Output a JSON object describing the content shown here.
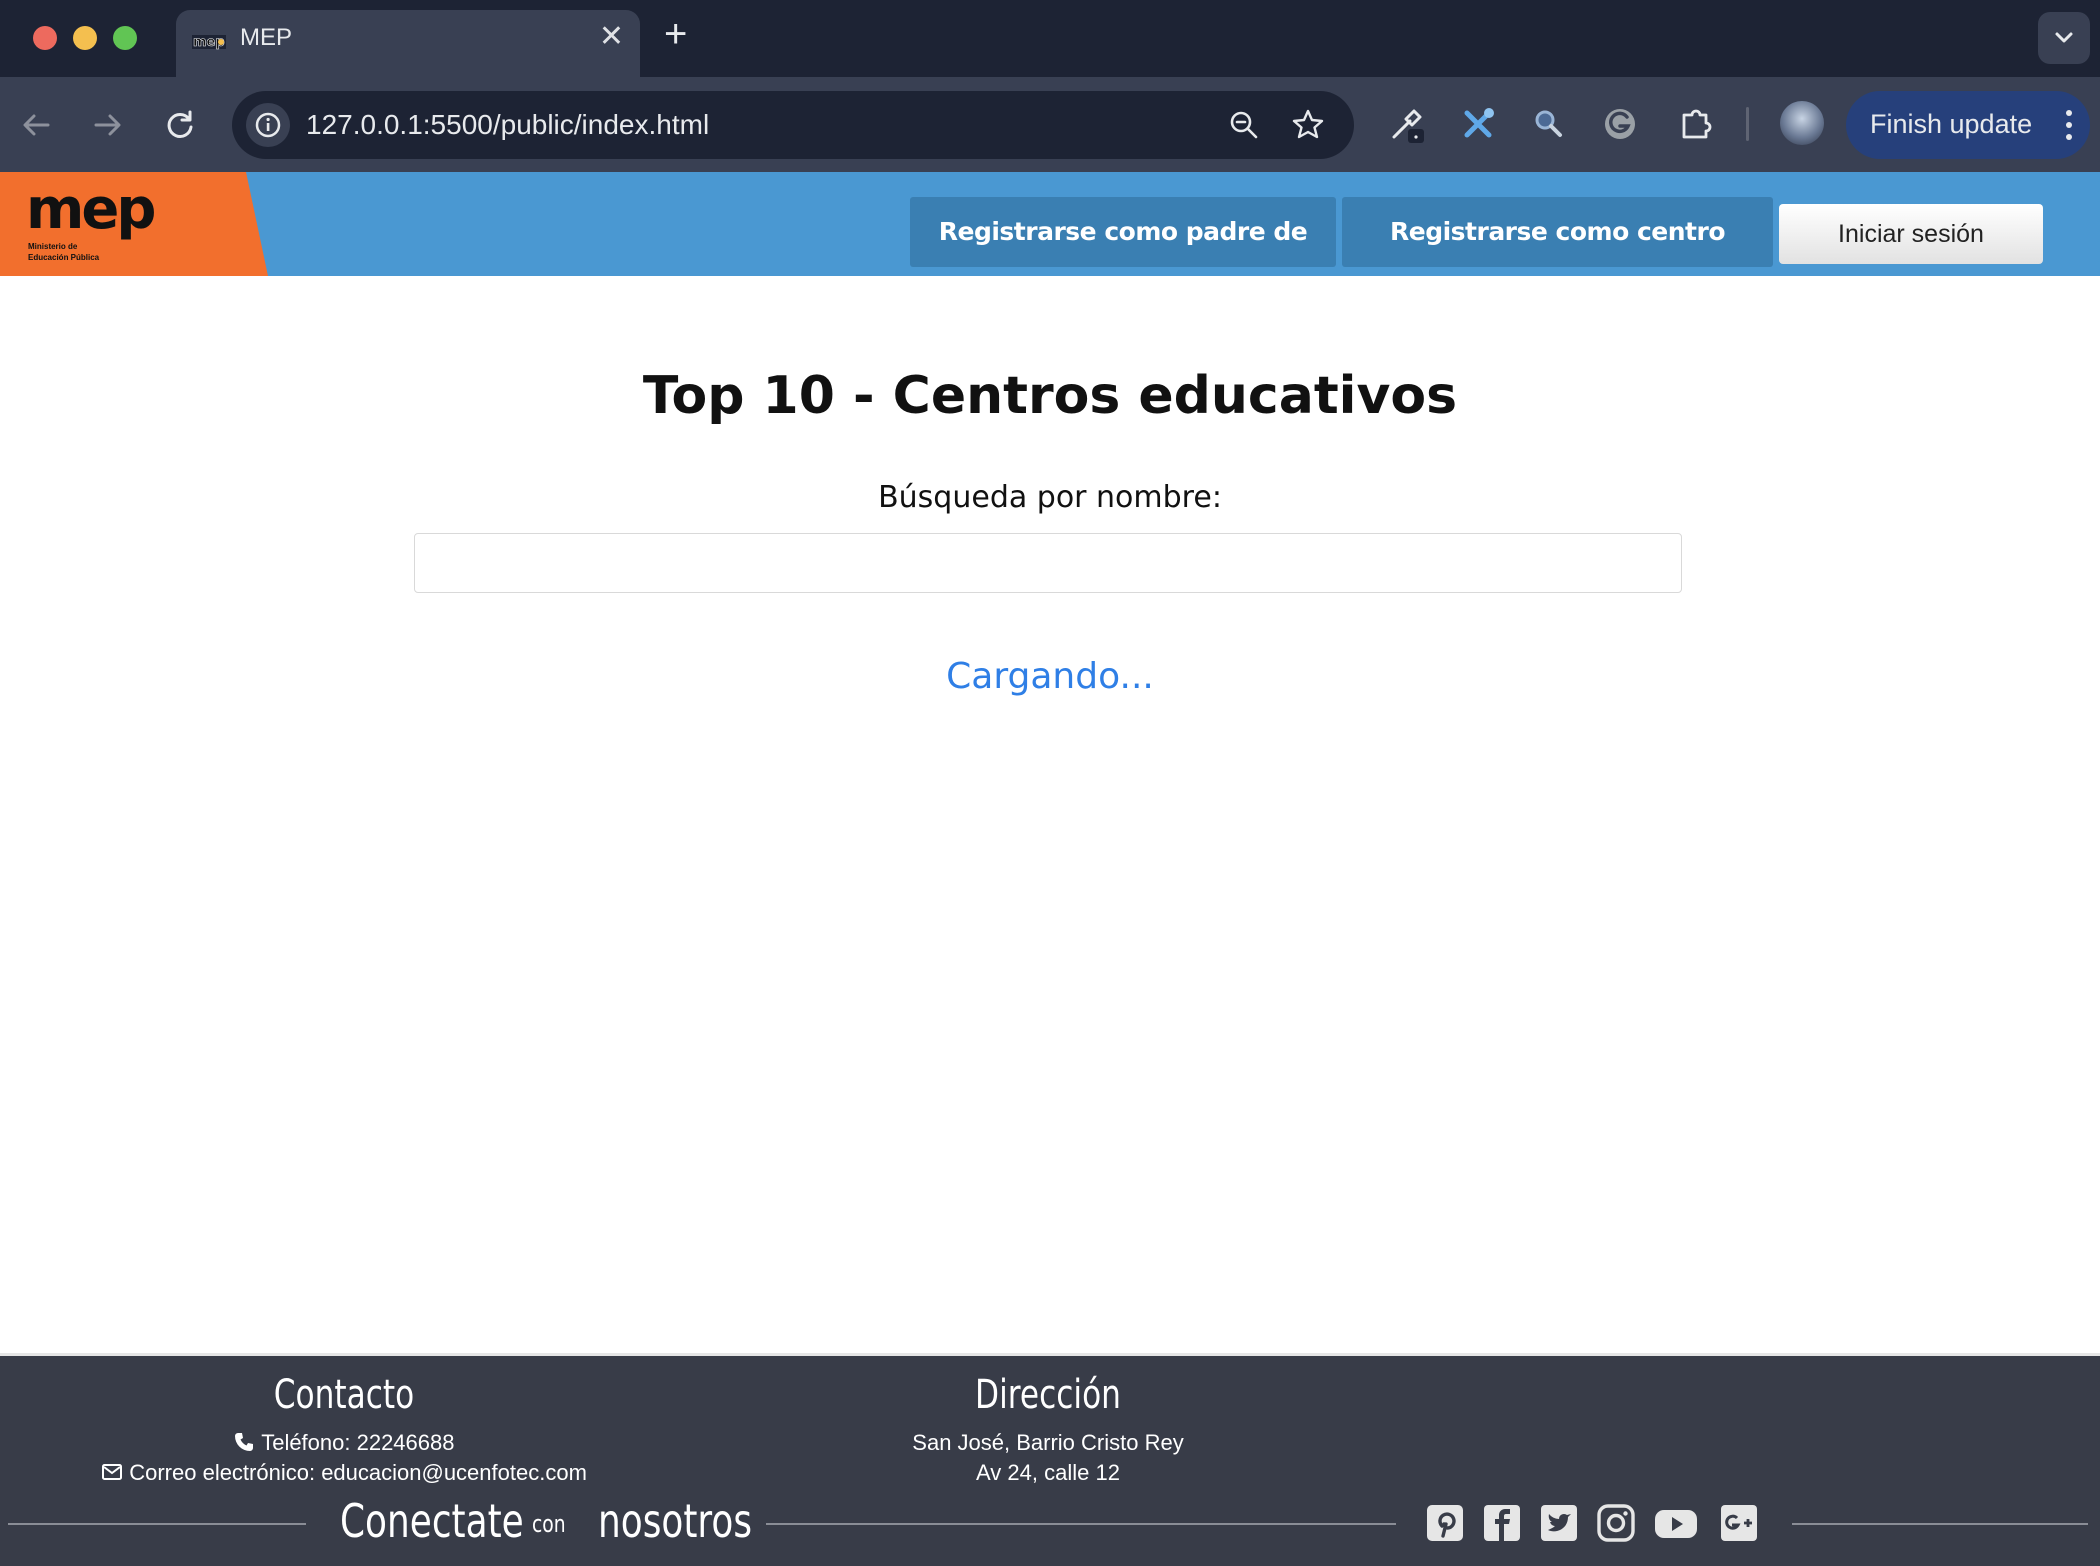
{
  "browser": {
    "tab": {
      "title": "MEP",
      "favicon": "mep-favicon"
    },
    "address_bar": {
      "url": "127.0.0.1:5500/public/index.html"
    },
    "update_button": {
      "label": "Finish update"
    },
    "icons": [
      "back-icon",
      "forward-icon",
      "reload-icon",
      "site-info-icon",
      "zoom-icon",
      "bookmark-star-icon",
      "eyedropper-extension-icon",
      "tools-extension-icon",
      "search-extension-icon",
      "grammarly-extension-icon",
      "extensions-puzzle-icon",
      "profile-avatar",
      "kebab-menu-icon",
      "tab-search-chevron-icon"
    ]
  },
  "header": {
    "logo": {
      "word": "mep",
      "line1": "Ministerio de",
      "line2": "Educación Pública"
    },
    "nav": {
      "register_parent": "Registrarse como padre de familia",
      "register_school": "Registrarse como centro educativo",
      "login": "Iniciar sesión"
    },
    "colors": {
      "bar": "#4a98d2",
      "logo_bg": "#f26f2d",
      "button_bg": "#3a7fb2"
    }
  },
  "main": {
    "title": "Top 10 - Centros educativos",
    "search": {
      "label": "Búsqueda por nombre:",
      "value": ""
    },
    "status": "Cargando...",
    "status_color": "#2f7fe6"
  },
  "footer": {
    "contact": {
      "heading": "Contacto",
      "phone": "Teléfono: 22246688",
      "email": "Correo electrónico: educacion@ucenfotec.com"
    },
    "address": {
      "heading": "Dirección",
      "line1": "San José, Barrio Cristo Rey",
      "line2": "Av 24, calle 12"
    },
    "connect": {
      "word1": "Conectate",
      "word2": "con",
      "word3": "nosotros"
    },
    "social": [
      "pinterest-icon",
      "facebook-icon",
      "twitter-icon",
      "instagram-icon",
      "youtube-icon",
      "google-plus-icon"
    ]
  }
}
